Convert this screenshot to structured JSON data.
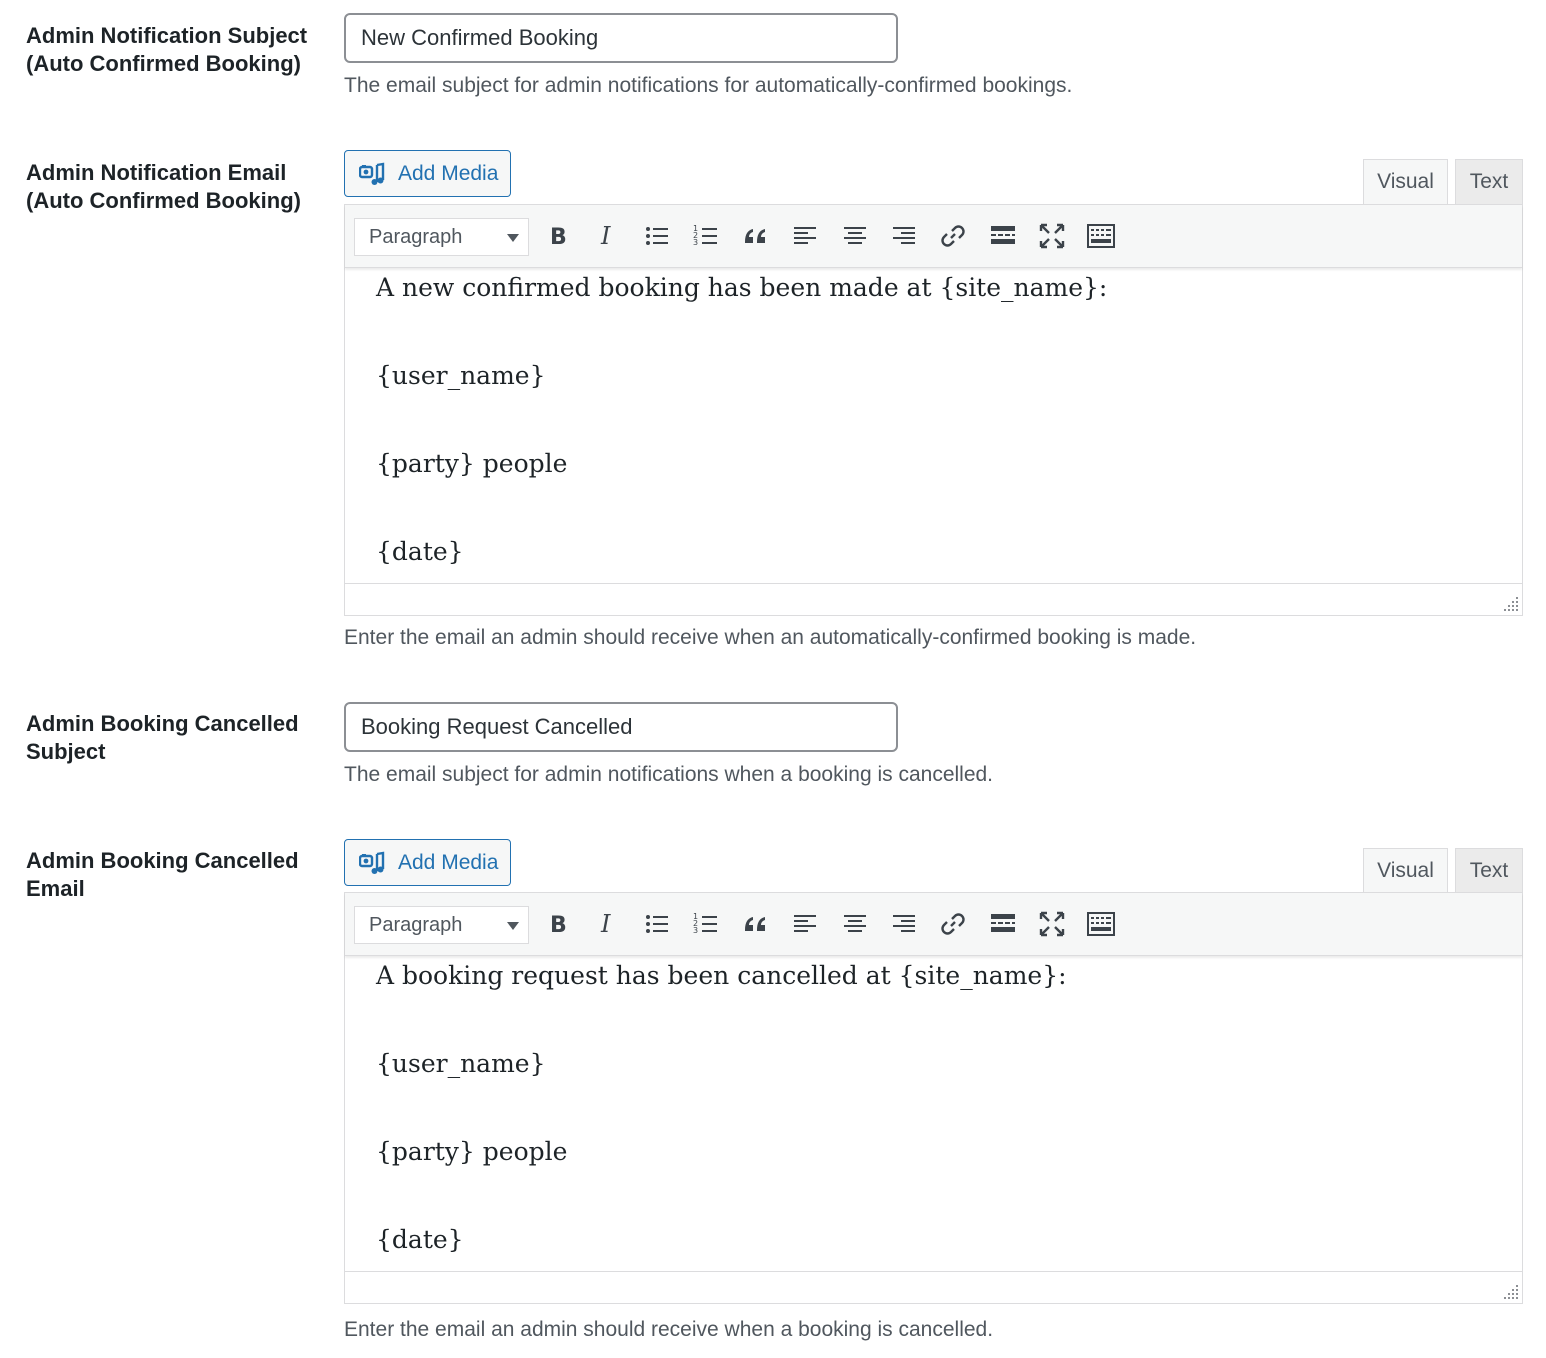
{
  "fields": [
    {
      "label_lines": [
        "Admin Notification Subject",
        "(Auto Confirmed Booking)"
      ],
      "type": "text",
      "value": "New Confirmed Booking",
      "description": "The email subject for admin notifications for automatically-confirmed bookings."
    },
    {
      "label_lines": [
        "Admin Notification Email",
        "(Auto Confirmed Booking)"
      ],
      "type": "editor",
      "add_media_label": "Add Media",
      "tabs": [
        "Visual",
        "Text"
      ],
      "format": "Paragraph",
      "content": [
        "A new confirmed booking has been made at {site_name}:",
        "{user_name}",
        "{party} people",
        "{date}"
      ],
      "description": "Enter the email an admin should receive when an automatically-confirmed booking is made."
    },
    {
      "label_lines": [
        "Admin Booking Cancelled",
        "Subject"
      ],
      "type": "text",
      "value": "Booking Request Cancelled",
      "description": "The email subject for admin notifications when a booking is cancelled."
    },
    {
      "label_lines": [
        "Admin Booking Cancelled",
        "Email"
      ],
      "type": "editor",
      "add_media_label": "Add Media",
      "tabs": [
        "Visual",
        "Text"
      ],
      "format": "Paragraph",
      "content": [
        "A booking request has been cancelled at {site_name}:",
        "{user_name}",
        "{party} people",
        "{date}"
      ],
      "description": "Enter the email an admin should receive when a booking is cancelled."
    }
  ],
  "toolbar_icons": [
    "bold-icon",
    "italic-icon",
    "bulleted-list-icon",
    "numbered-list-icon",
    "blockquote-icon",
    "align-left-icon",
    "align-center-icon",
    "align-right-icon",
    "link-icon",
    "read-more-icon",
    "fullscreen-icon",
    "toolbar-toggle-icon"
  ],
  "colors": {
    "accent": "#2271b1",
    "text": "#1d2327",
    "description": "#50575e",
    "border": "#dcdcde"
  }
}
